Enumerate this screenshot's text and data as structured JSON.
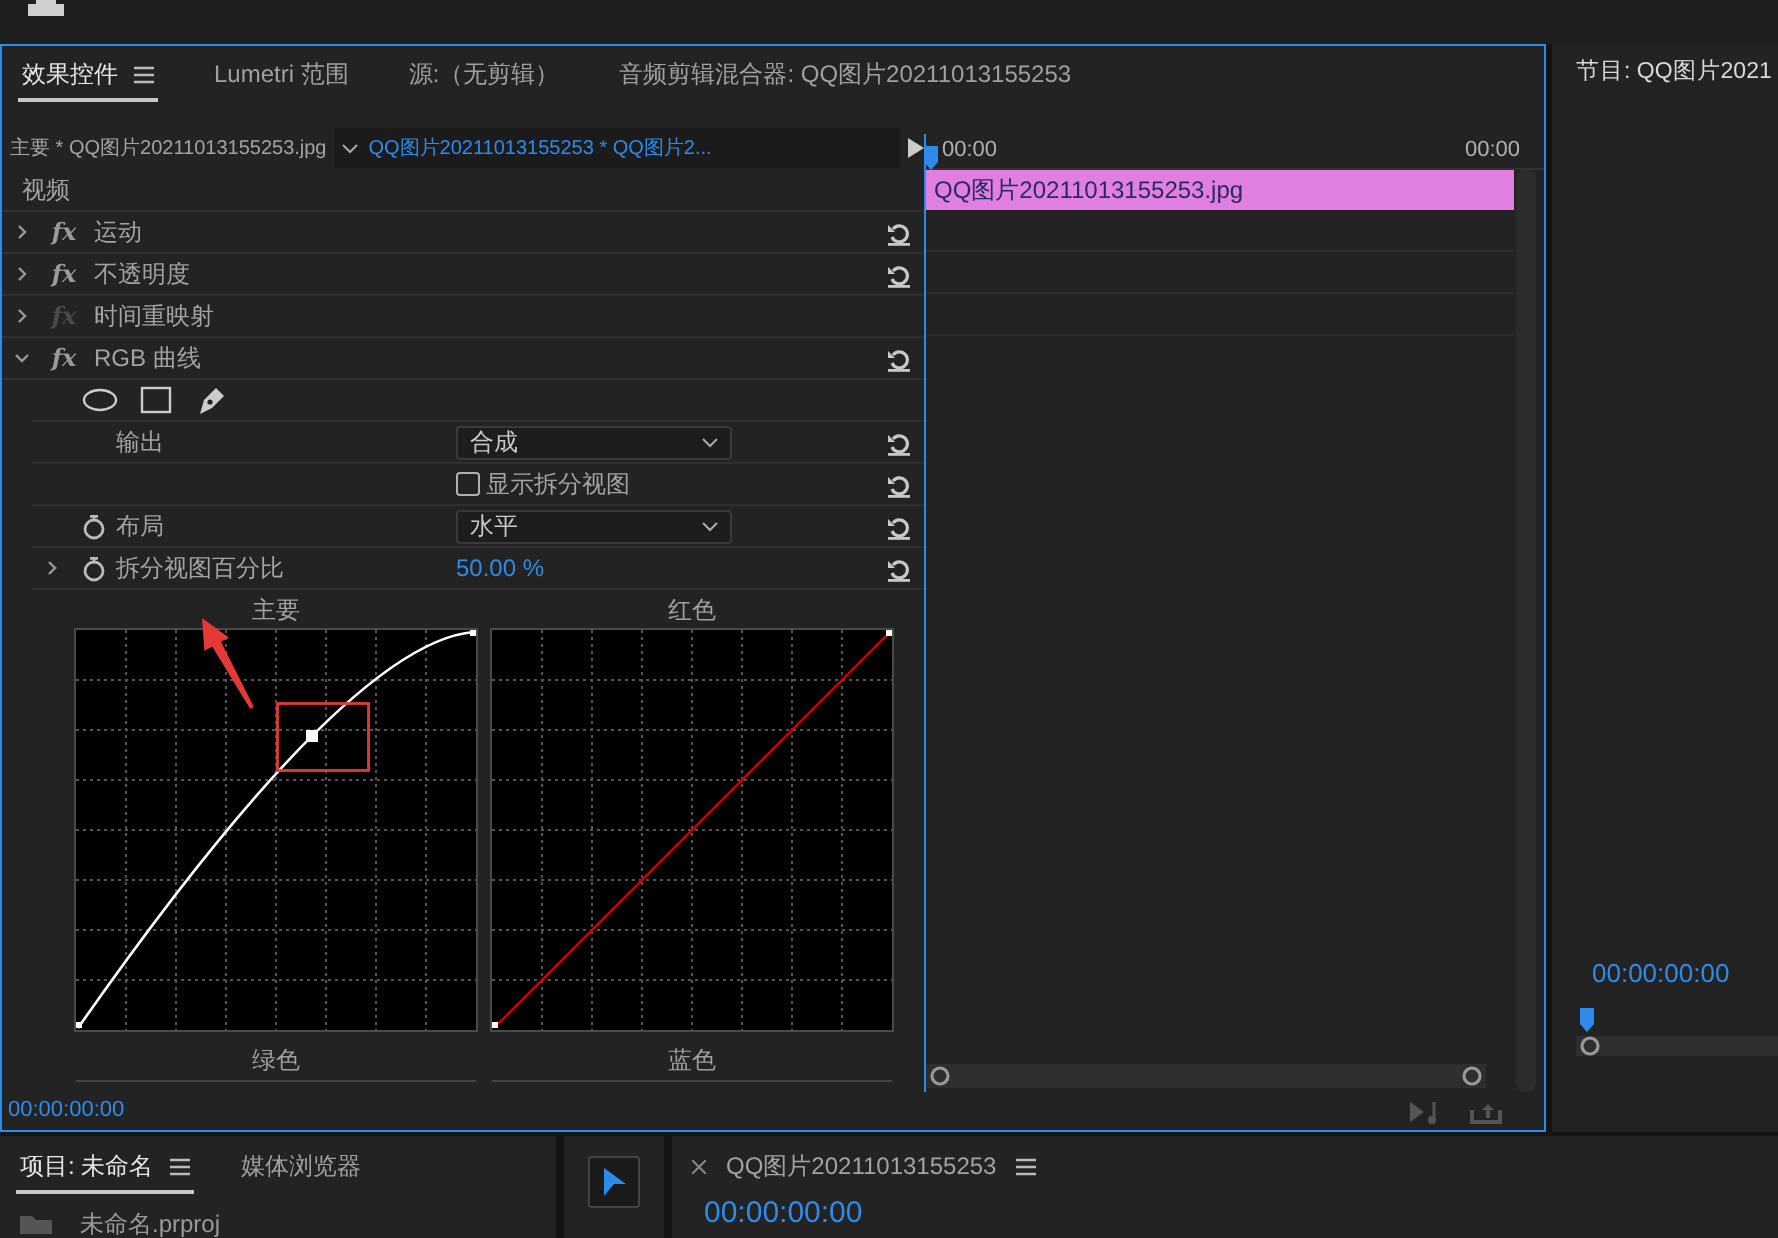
{
  "effect_controls": {
    "tabs": [
      {
        "label": "效果控件",
        "selected": true,
        "menu": true
      },
      {
        "label": "Lumetri 范围",
        "selected": false,
        "menu": false
      },
      {
        "label": "源:（无剪辑）",
        "selected": false,
        "menu": false
      },
      {
        "label": "音频剪辑混合器: QQ图片20211013155253",
        "selected": false,
        "menu": false
      }
    ],
    "source_clip": "主要 * QQ图片20211013155253.jpg",
    "sequence_clip": "QQ图片20211013155253  * QQ图片2...",
    "section": "视频",
    "effects": [
      {
        "name": "运动",
        "fx_label": "fx",
        "expanded": false,
        "enabled": true,
        "resettable": true
      },
      {
        "name": "不透明度",
        "fx_label": "fx",
        "expanded": false,
        "enabled": true,
        "resettable": true
      },
      {
        "name": "时间重映射",
        "fx_label": "fx",
        "expanded": false,
        "enabled": false,
        "resettable": false
      },
      {
        "name": "RGB 曲线",
        "fx_label": "fx",
        "expanded": true,
        "enabled": true,
        "resettable": true
      }
    ],
    "properties": [
      {
        "kind": "tools",
        "resettable": false
      },
      {
        "kind": "dropdown",
        "label": "输出",
        "value": "合成",
        "stopwatch": false,
        "expandable": false,
        "resettable": true
      },
      {
        "kind": "checkbox",
        "label": "显示拆分视图",
        "checked": false,
        "resettable": true
      },
      {
        "kind": "dropdown",
        "label": "布局",
        "value": "水平",
        "stopwatch": true,
        "expandable": false,
        "resettable": true
      },
      {
        "kind": "number",
        "label": "拆分视图百分比",
        "value": "50.00 %",
        "stopwatch": true,
        "expandable": true,
        "resettable": true
      }
    ],
    "curves": [
      {
        "label": "主要",
        "kind": "master",
        "highlight_box": true,
        "pointer_arrow": true
      },
      {
        "label": "红色",
        "kind": "red"
      },
      {
        "label": "绿色",
        "kind": "green"
      },
      {
        "label": "蓝色",
        "kind": "blue"
      }
    ],
    "timecode": "00:00:00:00",
    "timeline": {
      "ruler_start": "00:00",
      "ruler_end": "00:00",
      "clip": "QQ图片20211013155253.jpg"
    }
  },
  "program": {
    "title": "节目: QQ图片2021",
    "timecode": "00:00:00:00"
  },
  "project": {
    "tabs": [
      {
        "label": "项目: 未命名",
        "selected": true,
        "menu": true
      },
      {
        "label": "媒体浏览器",
        "selected": false,
        "menu": false
      }
    ],
    "item": "未命名.prproj"
  },
  "tools": [
    {
      "kind": "selection",
      "selected": true
    }
  ],
  "sequence": {
    "title": "QQ图片20211013155253",
    "timecode": "00:00:00:00"
  }
}
